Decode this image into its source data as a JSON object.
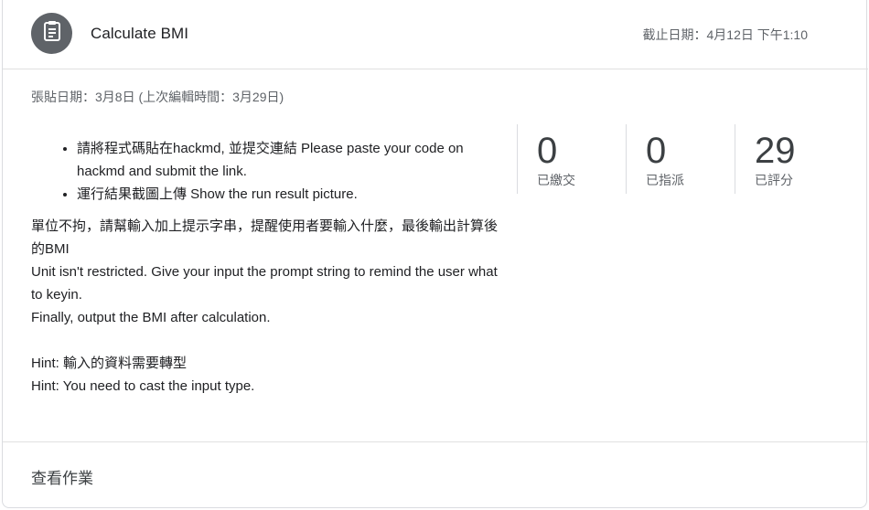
{
  "header": {
    "icon": "assignment-icon",
    "title": "Calculate BMI",
    "due": "截止日期：4月12日 下午1:10"
  },
  "posted": "張貼日期：3月8日 (上次編輯時間：3月29日)",
  "instructions": {
    "bullets": [
      "請將程式碼貼在hackmd, 並提交連結 Please paste your code on hackmd and submit the link.",
      "運行結果截圖上傳 Show the run result picture."
    ],
    "paragraphs": [
      "單位不拘，請幫輸入加上提示字串，提醒使用者要輸入什麼，最後輸出計算後的BMI",
      "Unit isn't restricted. Give your input the prompt string to remind the user what to keyin.",
      "Finally, output the BMI after calculation.",
      "",
      "Hint: 輸入的資料需要轉型",
      "Hint: You need to cast the input type."
    ]
  },
  "stats": [
    {
      "value": "0",
      "label": "已繳交"
    },
    {
      "value": "0",
      "label": "已指派"
    },
    {
      "value": "29",
      "label": "已評分"
    }
  ],
  "footer": {
    "link_label": "查看作業"
  },
  "colors": {
    "avatar_bg": "#5f6368",
    "divider": "#dadce0",
    "text_primary": "#202124",
    "text_secondary": "#5f6368"
  }
}
